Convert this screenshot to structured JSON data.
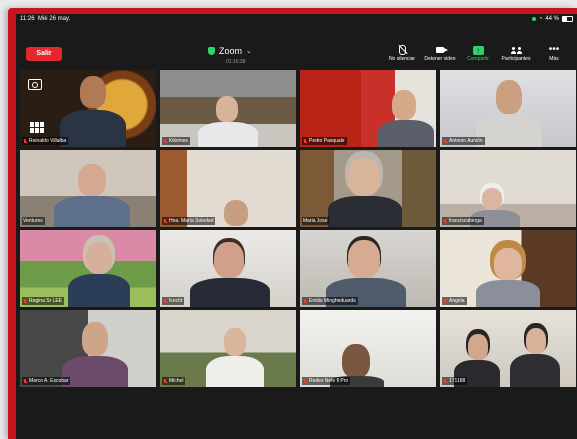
{
  "status_bar": {
    "time": "11:26",
    "date": "Mié 26 may.",
    "battery": "44 %"
  },
  "meeting": {
    "leave_label": "Salir",
    "app_name": "Zoom",
    "timer": "01:16:38"
  },
  "toolbar": [
    {
      "label": "No silenciar",
      "icon": "mic-muted-icon",
      "active": false
    },
    {
      "label": "Detener video",
      "icon": "video-icon",
      "active": false
    },
    {
      "label": "Compartir",
      "icon": "share-screen-icon",
      "active": true
    },
    {
      "label": "Participantes",
      "icon": "participants-icon",
      "active": false
    },
    {
      "label": "Más",
      "icon": "more-icon",
      "active": false
    }
  ],
  "participants": [
    {
      "name": "Reinaldo Villalba",
      "muted": true
    },
    {
      "name": "Kiloimes",
      "muted": true
    },
    {
      "name": "Pedro Pasquale",
      "muted": true
    },
    {
      "name": "Antonio Aunión",
      "muted": true
    },
    {
      "name": "Ventures",
      "muted": false
    },
    {
      "name": "Hna. María Soledad",
      "muted": true
    },
    {
      "name": "Maria Jose",
      "muted": false
    },
    {
      "name": "franciscaberga",
      "muted": true
    },
    {
      "name": "Regina Sr LEE",
      "muted": true
    },
    {
      "name": "fcecht",
      "muted": true
    },
    {
      "name": "Emilio Mingheduards",
      "muted": true
    },
    {
      "name": "Angela",
      "muted": true
    },
    {
      "name": "Marco A. Escobar",
      "muted": true
    },
    {
      "name": "Michel",
      "muted": true
    },
    {
      "name": "Redes Nele fl Pro",
      "muted": true
    },
    {
      "name": "171188",
      "muted": true
    }
  ],
  "colors": {
    "leave": "#e4262f",
    "active": "#2fd36a",
    "active_speaker": "#7ae07a",
    "muted": "#ff3b30"
  }
}
